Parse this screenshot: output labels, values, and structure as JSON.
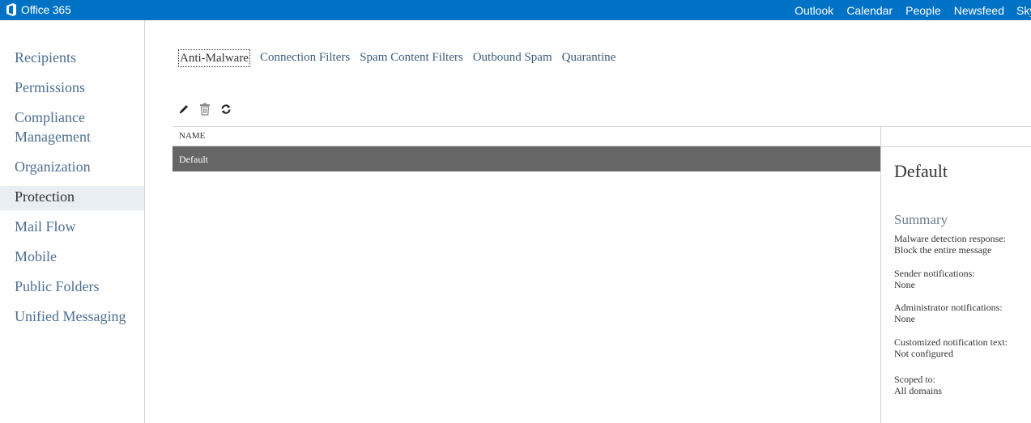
{
  "brand": {
    "name": "Office 365"
  },
  "topnav": {
    "items": [
      "Outlook",
      "Calendar",
      "People",
      "Newsfeed",
      "Sky"
    ]
  },
  "leftnav": {
    "items": [
      "Recipients",
      "Permissions",
      "Compliance",
      "Management",
      "Organization",
      "Protection",
      "Mail Flow",
      "Mobile",
      "Public Folders",
      "Unified Messaging"
    ],
    "active": "Protection"
  },
  "tabs": [
    "Anti-Malware",
    "Connection Filters",
    "Spam Content Filters",
    "Outbound Spam",
    "Quarantine"
  ],
  "toolbar": {
    "edit": "pencil-icon",
    "delete": "trash-icon",
    "refresh": "refresh-icon"
  },
  "list": {
    "header": "NAME",
    "rows": [
      "Default"
    ]
  },
  "detail": {
    "title": "Default",
    "summary_title": "Summary",
    "fields": [
      {
        "label": "Malware detection response:",
        "value": "Block the entire message"
      },
      {
        "label": "Sender notifications:",
        "value": "None"
      },
      {
        "label": "Administrator notifications:",
        "value": "None"
      },
      {
        "label": "Customized notification text:",
        "value": "Not configured"
      },
      {
        "label": "Scoped to:",
        "value": "All domains"
      }
    ]
  },
  "colors": {
    "topbar": "#0072c6",
    "selected_row": "#666666",
    "nav_link": "#4d6f91"
  }
}
